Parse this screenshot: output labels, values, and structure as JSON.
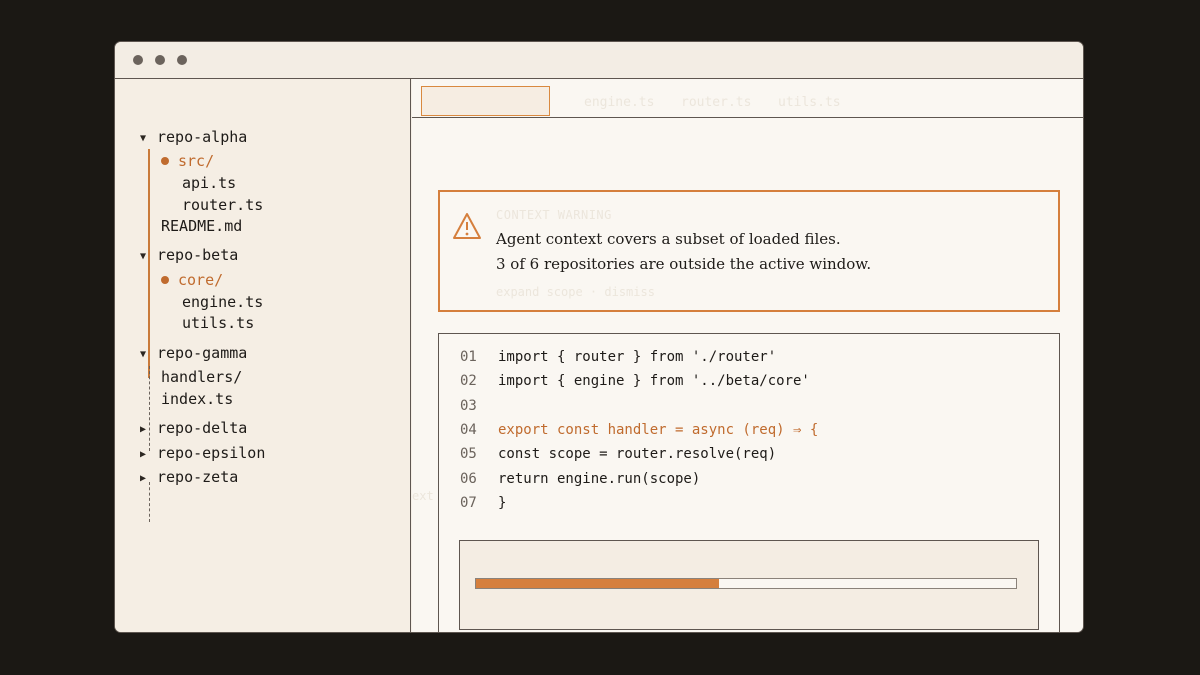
{
  "window": {
    "controls": [
      "close",
      "minimize",
      "maximize"
    ]
  },
  "sidebar": {
    "repos": [
      {
        "name": "repo-alpha",
        "expanded": true
      },
      {
        "name": "repo-beta",
        "expanded": true
      },
      {
        "name": "repo-gamma",
        "expanded": true
      },
      {
        "name": "repo-delta",
        "expanded": false
      },
      {
        "name": "repo-epsilon",
        "expanded": false
      },
      {
        "name": "repo-zeta",
        "expanded": false
      }
    ],
    "alpha_items": [
      "src/",
      "api.ts",
      "router.ts",
      "README.md"
    ],
    "beta_items": [
      "core/",
      "engine.ts",
      "utils.ts"
    ],
    "gamma_items": [
      "handlers/",
      "index.ts"
    ],
    "caret_expanded": "▼",
    "caret_collapsed": "▶"
  },
  "tabs": [
    "engine.ts",
    "router.ts",
    "utils.ts"
  ],
  "ghost_label": "ext",
  "warning": {
    "title": "CONTEXT WARNING",
    "line1": "Agent context covers a subset of loaded files.",
    "line2": "3 of 6 repositories are outside the active window.",
    "actions": "expand scope · dismiss"
  },
  "code": {
    "lines": [
      {
        "num": "01",
        "text": "import { router } from './router'",
        "highlight": false
      },
      {
        "num": "02",
        "text": "import { engine } from '../beta/core'",
        "highlight": false
      },
      {
        "num": "03",
        "text": "",
        "highlight": false
      },
      {
        "num": "04",
        "text": "export const handler = async (req) ⇒ {",
        "highlight": true
      },
      {
        "num": "05",
        "text": "const scope = router.resolve(req)",
        "highlight": false
      },
      {
        "num": "06",
        "text": "return engine.run(scope)",
        "highlight": false
      },
      {
        "num": "07",
        "text": "}",
        "highlight": false
      }
    ]
  },
  "progress": {
    "fraction": 0.45
  },
  "colors": {
    "accent": "#d57f3d",
    "background": "#1b1814",
    "panel": "#f5efe6"
  }
}
